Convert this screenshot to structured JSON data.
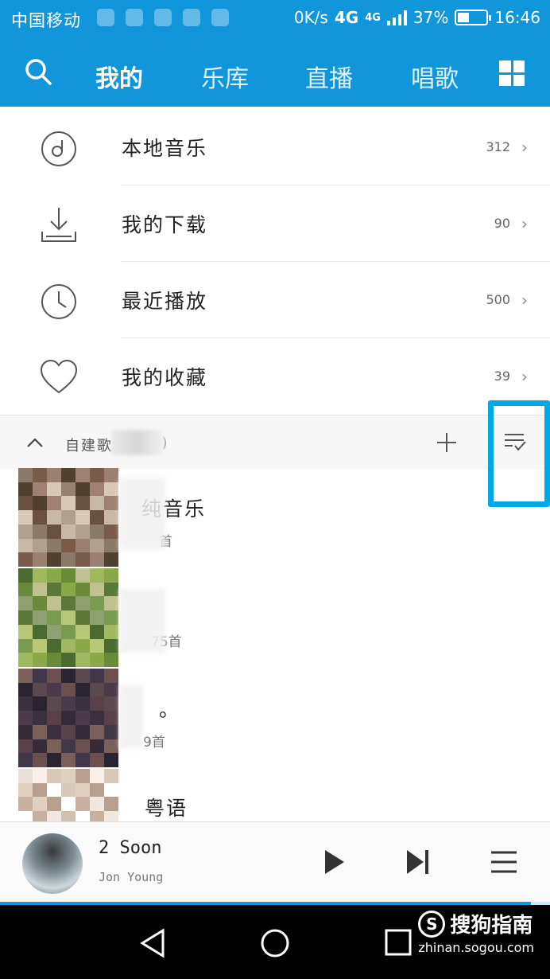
{
  "status_bar": {
    "carrier": "中国移动",
    "speed": "0K/s",
    "network": "4G",
    "network2": "4G",
    "battery": "37%",
    "battery_level": 0.37,
    "time": "16:46"
  },
  "nav": {
    "tabs": [
      {
        "label": "我的",
        "active": true
      },
      {
        "label": "乐库",
        "active": false
      },
      {
        "label": "直播",
        "active": false
      },
      {
        "label": "唱歌",
        "active": false
      }
    ],
    "search_icon": "search-icon",
    "more_icon": "grid-icon",
    "accent_color": "#1296db"
  },
  "menu": [
    {
      "label": "本地音乐",
      "count": "312",
      "icon": "disc-icon"
    },
    {
      "label": "我的下载",
      "count": "90",
      "icon": "download-icon"
    },
    {
      "label": "最近播放",
      "count": "500",
      "icon": "clock-icon"
    },
    {
      "label": "我的收藏",
      "count": "39",
      "icon": "heart-icon"
    }
  ],
  "playlists_header": {
    "title": "自建歌",
    "title_suffix": "2)",
    "add_icon": "plus-icon",
    "manage_icon": "list-check-icon",
    "highlight_color": "#00a9e6"
  },
  "playlists": [
    {
      "name": "纯音乐",
      "sub": "首"
    },
    {
      "name": "",
      "sub": "75首"
    },
    {
      "name": "。",
      "sub": "9首"
    },
    {
      "name": "粤语",
      "sub": ""
    }
  ],
  "player": {
    "song": "2 Soon",
    "artist": "Jon Young",
    "play_icon": "play-icon",
    "next_icon": "skip-next-icon",
    "queue_icon": "playlist-icon",
    "progress": 0.965
  },
  "watermark": {
    "brand": "搜狗指南",
    "url": "zhinan.sogou.com"
  }
}
